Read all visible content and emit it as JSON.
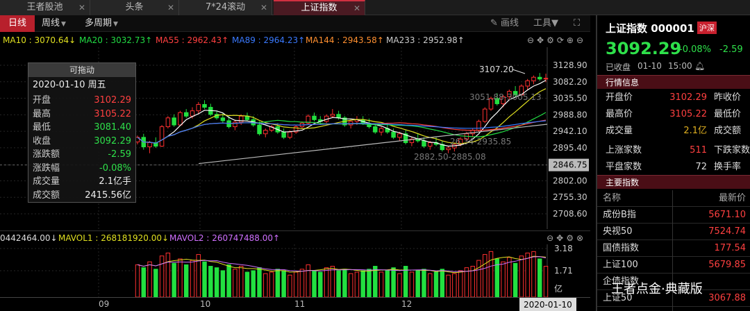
{
  "tabs": [
    {
      "label": "王者股池"
    },
    {
      "label": "头条"
    },
    {
      "label": "7*24滚动"
    },
    {
      "label": "上证指数"
    }
  ],
  "toolbar": {
    "daily": "日线",
    "weekly": "周线",
    "multi": "多周期",
    "draw": "画线",
    "tools": "工具"
  },
  "ma": [
    {
      "label": "MA10 : 3070.64",
      "arrow": "↓",
      "color": "#e0e020"
    },
    {
      "label": "MA20 : 3032.73",
      "arrow": "↑",
      "color": "#22dd44"
    },
    {
      "label": "MA55 : 2962.43",
      "arrow": "↑",
      "color": "#ff4040"
    },
    {
      "label": "MA89 : 2964.23",
      "arrow": "↑",
      "color": "#3a7aff"
    },
    {
      "label": "MA144 : 2943.58",
      "arrow": "↑",
      "color": "#ff9030"
    },
    {
      "label": "MA233 : 2952.98",
      "arrow": "↑",
      "color": "#cccccc"
    }
  ],
  "vol": [
    {
      "label": "0442464.00",
      "arrow": "↓",
      "color": "#ddd"
    },
    {
      "label": "MAVOL1 : 268181920.00",
      "arrow": "↓",
      "color": "#e0e020"
    },
    {
      "label": "MAVOL2 : 260747488.00",
      "arrow": "↑",
      "color": "#d070ff"
    }
  ],
  "yaxis": [
    "3128.90",
    "3082.20",
    "3035.50",
    "2988.80",
    "2942.10",
    "2895.40",
    "2846.75",
    "2802.00",
    "2755.30",
    "2708.60"
  ],
  "vol_axis": [
    "3.18",
    "1.71",
    "亿"
  ],
  "x_labels": [
    "09",
    "10",
    "11",
    "12",
    "2020-01-10"
  ],
  "annotations": {
    "high": "3107.20",
    "mid1": "3051.88-3005.13",
    "mid2": "26.34-2935.85",
    "low": "2882.50-2885.08"
  },
  "tooltip": {
    "title": "可拖动",
    "date": "2020-01-10 周五",
    "rows": [
      {
        "k": "开盘",
        "v": "3102.29",
        "c": "#ff4040"
      },
      {
        "k": "最高",
        "v": "3105.22",
        "c": "#ff4040"
      },
      {
        "k": "最低",
        "v": "3081.40",
        "c": "#2ee04a"
      },
      {
        "k": "收盘",
        "v": "3092.29",
        "c": "#2ee04a"
      },
      {
        "k": "涨跌额",
        "v": "-2.59",
        "c": "#2ee04a"
      },
      {
        "k": "涨跌幅",
        "v": "-0.08%",
        "c": "#2ee04a"
      },
      {
        "k": "成交量",
        "v": "2.1亿手",
        "c": "#eeeeee"
      },
      {
        "k": "成交额",
        "v": "2415.56亿",
        "c": "#eeeeee"
      }
    ]
  },
  "panel": {
    "name": "上证指数 000001",
    "tag": "沪深",
    "price": "3092.29",
    "pct": "-0.08%",
    "chg": "-2.59",
    "status": "已收盘",
    "date": "01-10",
    "time": "15:00",
    "sec1": "行情信息",
    "kv": [
      {
        "k": "开盘价",
        "v": "3102.29",
        "k2": "昨收价",
        "c": "#ff4040"
      },
      {
        "k": "最高价",
        "v": "3105.22",
        "k2": "最低价",
        "c": "#ff4040"
      },
      {
        "k": "成交量",
        "v": "2.1亿",
        "k2": "成交额",
        "c": "#e0b020"
      }
    ],
    "kv2": [
      {
        "k": "上涨家数",
        "v": "511",
        "k2": "下跌家数",
        "c": "#ff4040"
      },
      {
        "k": "平盘家数",
        "v": "72",
        "k2": "换手率",
        "c": "#dddddd"
      }
    ],
    "sec2": "主要指数",
    "list_head": {
      "name": "名称",
      "price": "最新价"
    },
    "list": [
      {
        "name": "成份B指",
        "price": "5671.10"
      },
      {
        "name": "央视50",
        "price": "7524.74"
      },
      {
        "name": "国债指数",
        "price": "177.54"
      },
      {
        "name": "上证100",
        "price": "5679.85"
      },
      {
        "name": "企债指数",
        "price": ""
      },
      {
        "name": "上证50",
        "price": "3067.88"
      }
    ]
  },
  "watermark": "王者点金·典藏版",
  "chart_data": {
    "type": "candlestick",
    "candles": [
      [
        2912,
        2930,
        2905,
        2925
      ],
      [
        2925,
        2935,
        2890,
        2898
      ],
      [
        2898,
        2915,
        2880,
        2910
      ],
      [
        2910,
        2925,
        2895,
        2900
      ],
      [
        2900,
        2960,
        2898,
        2955
      ],
      [
        2955,
        2985,
        2950,
        2980
      ],
      [
        2980,
        2990,
        2955,
        2960
      ],
      [
        2960,
        3000,
        2958,
        2995
      ],
      [
        2995,
        3005,
        2980,
        2985
      ],
      [
        2985,
        3010,
        2978,
        3000
      ],
      [
        3000,
        3025,
        2990,
        3018
      ],
      [
        3018,
        3030,
        3005,
        3010
      ],
      [
        3010,
        3020,
        2985,
        2990
      ],
      [
        2990,
        3000,
        2975,
        2980
      ],
      [
        2980,
        2995,
        2965,
        2972
      ],
      [
        2972,
        2985,
        2950,
        2955
      ],
      [
        2955,
        2975,
        2945,
        2968
      ],
      [
        2968,
        2990,
        2960,
        2985
      ],
      [
        2985,
        2995,
        2970,
        2975
      ],
      [
        2975,
        2985,
        2955,
        2960
      ],
      [
        2960,
        2970,
        2930,
        2935
      ],
      [
        2935,
        2950,
        2925,
        2945
      ],
      [
        2945,
        2960,
        2940,
        2955
      ],
      [
        2955,
        2965,
        2935,
        2940
      ],
      [
        2940,
        2950,
        2920,
        2925
      ],
      [
        2925,
        2945,
        2920,
        2940
      ],
      [
        2940,
        2960,
        2935,
        2955
      ],
      [
        2955,
        2970,
        2950,
        2965
      ],
      [
        2965,
        2990,
        2960,
        2985
      ],
      [
        2985,
        2995,
        2970,
        2975
      ],
      [
        2975,
        2985,
        2960,
        2970
      ],
      [
        2970,
        2990,
        2965,
        2985
      ],
      [
        2985,
        3005,
        2980,
        2990
      ],
      [
        2990,
        3000,
        2975,
        2980
      ],
      [
        2980,
        2985,
        2955,
        2960
      ],
      [
        2960,
        2975,
        2950,
        2970
      ],
      [
        2970,
        2985,
        2960,
        2975
      ],
      [
        2975,
        2985,
        2960,
        2965
      ],
      [
        2965,
        2978,
        2950,
        2955
      ],
      [
        2955,
        2965,
        2935,
        2940
      ],
      [
        2940,
        2955,
        2930,
        2950
      ],
      [
        2950,
        2960,
        2935,
        2940
      ],
      [
        2940,
        2950,
        2920,
        2925
      ],
      [
        2925,
        2940,
        2915,
        2935
      ],
      [
        2935,
        2945,
        2905,
        2910
      ],
      [
        2910,
        2925,
        2900,
        2920
      ],
      [
        2920,
        2935,
        2910,
        2915
      ],
      [
        2915,
        2925,
        2895,
        2900
      ],
      [
        2900,
        2915,
        2890,
        2910
      ],
      [
        2910,
        2925,
        2900,
        2905
      ],
      [
        2905,
        2915,
        2885,
        2890
      ],
      [
        2890,
        2900,
        2880,
        2895
      ],
      [
        2895,
        2910,
        2885,
        2905
      ],
      [
        2905,
        2925,
        2900,
        2920
      ],
      [
        2920,
        2940,
        2915,
        2935
      ],
      [
        2935,
        2950,
        2925,
        2945
      ],
      [
        2945,
        2975,
        2940,
        2970
      ],
      [
        2970,
        3010,
        2965,
        3005
      ],
      [
        3005,
        3040,
        3000,
        3035
      ],
      [
        3035,
        3050,
        3015,
        3020
      ],
      [
        3020,
        3045,
        3010,
        3040
      ],
      [
        3040,
        3060,
        3030,
        3055
      ],
      [
        3055,
        3070,
        3040,
        3045
      ],
      [
        3045,
        3075,
        3042,
        3070
      ],
      [
        3070,
        3090,
        3060,
        3085
      ],
      [
        3085,
        3100,
        3075,
        3095
      ],
      [
        3095,
        3107,
        3085,
        3090
      ],
      [
        3090,
        3105,
        3081,
        3092
      ]
    ],
    "y_range": [
      2708.6,
      3128.9
    ],
    "volumes": [
      2.2,
      2.0,
      2.4,
      1.9,
      2.8,
      3.0,
      2.3,
      2.6,
      2.2,
      2.5,
      2.9,
      2.4,
      2.1,
      2.0,
      1.8,
      2.2,
      1.9,
      2.1,
      1.7,
      1.8,
      2.0,
      1.6,
      1.7,
      1.9,
      1.8,
      1.5,
      1.7,
      1.9,
      2.2,
      1.8,
      1.7,
      2.0,
      2.1,
      1.8,
      1.9,
      1.6,
      1.7,
      1.8,
      1.9,
      2.1,
      1.7,
      1.8,
      2.0,
      1.6,
      2.1,
      1.7,
      1.8,
      1.9,
      1.6,
      1.7,
      1.9,
      1.5,
      1.6,
      1.8,
      2.0,
      2.1,
      2.5,
      2.9,
      3.1,
      2.6,
      2.4,
      2.7,
      2.3,
      2.8,
      3.0,
      3.1,
      2.6,
      2.1
    ],
    "volume_range": [
      0,
      3.4
    ]
  }
}
